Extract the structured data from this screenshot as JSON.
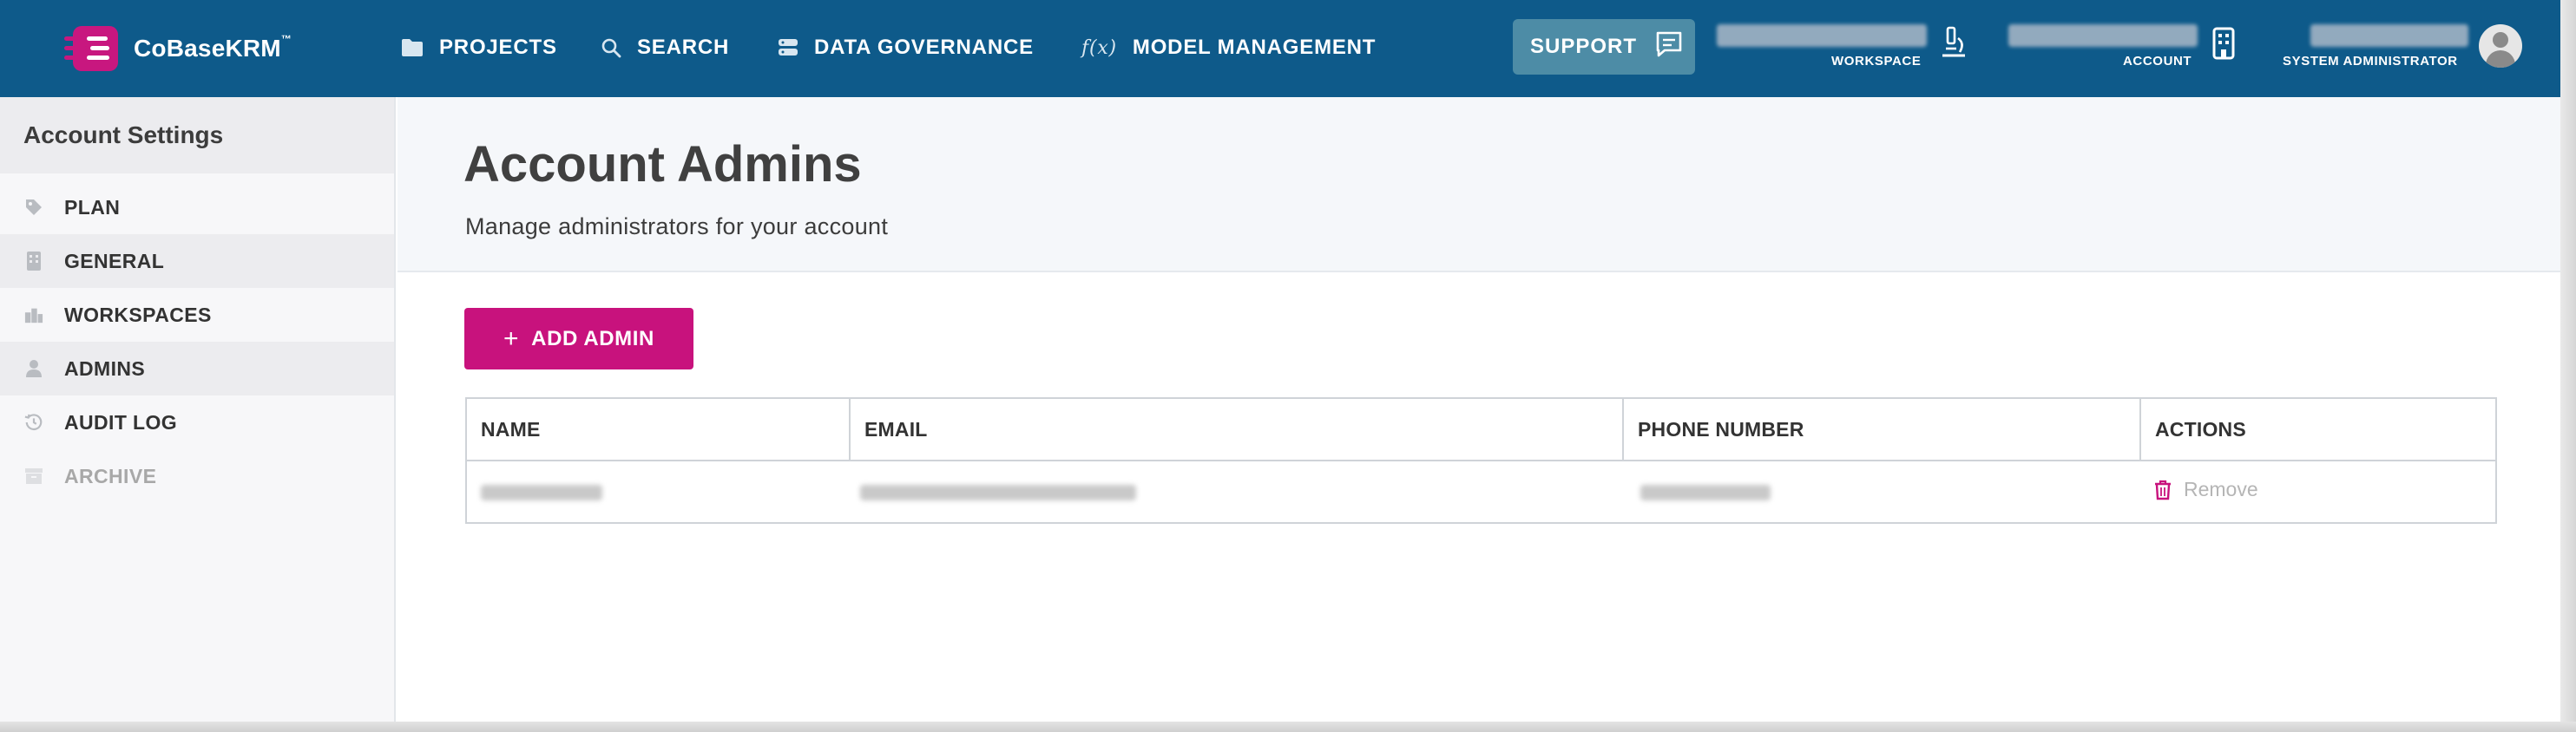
{
  "app": {
    "name": "CoBaseKRM",
    "trademark": "™"
  },
  "nav": {
    "items": [
      {
        "label": "PROJECTS",
        "icon": "folder-icon"
      },
      {
        "label": "SEARCH",
        "icon": "search-icon"
      },
      {
        "label": "DATA GOVERNANCE",
        "icon": "database-icon"
      },
      {
        "label": "MODEL MANAGEMENT",
        "icon": "function-icon"
      }
    ],
    "support_label": "SUPPORT",
    "workspace_label": "WORKSPACE",
    "account_label": "ACCOUNT",
    "user_role_label": "SYSTEM ADMINISTRATOR",
    "function_glyph": "f(x)"
  },
  "sidebar": {
    "title": "Account Settings",
    "items": [
      {
        "label": "PLAN",
        "icon": "tag-icon",
        "state": "normal"
      },
      {
        "label": "GENERAL",
        "icon": "building-icon",
        "state": "shaded"
      },
      {
        "label": "WORKSPACES",
        "icon": "workspaces-icon",
        "state": "normal"
      },
      {
        "label": "ADMINS",
        "icon": "person-icon",
        "state": "active"
      },
      {
        "label": "AUDIT LOG",
        "icon": "history-icon",
        "state": "normal"
      },
      {
        "label": "ARCHIVE",
        "icon": "archive-icon",
        "state": "disabled"
      }
    ]
  },
  "main": {
    "title": "Account Admins",
    "subtitle": "Manage administrators for your account",
    "add_button_label": "ADD ADMIN",
    "table": {
      "columns": [
        "NAME",
        "EMAIL",
        "PHONE NUMBER",
        "ACTIONS"
      ],
      "rows": [
        {
          "remove_label": "Remove"
        }
      ]
    }
  },
  "colors": {
    "topbar": "#0e5a8a",
    "accent": "#c8127d",
    "support_button": "#4d8ca6"
  }
}
